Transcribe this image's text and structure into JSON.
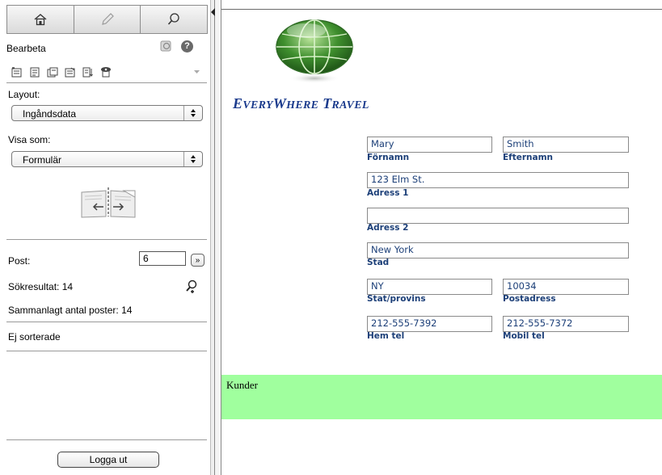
{
  "sidebar": {
    "title": "Bearbeta",
    "layout_label": "Layout:",
    "layout_value": "Ingåndsdata",
    "view_label": "Visa som:",
    "view_value": "Formulär",
    "record_label": "Post:",
    "record_value": "6",
    "found_label": "Sökresultat: 14",
    "total_label": "Sammanlagt antal poster: 14",
    "sort_label": "Ej sorterade",
    "logout_label": "Logga ut",
    "next_glyph": "»",
    "icons": [
      "home-icon",
      "pencil-icon",
      "search-icon"
    ]
  },
  "content": {
    "brand": {
      "e": "E",
      "very": "VERY",
      "w": "W",
      "here": "HERE",
      "t": "T",
      "ravel": "RAVEL"
    },
    "fields": {
      "first_name": {
        "value": "Mary",
        "label": "Förnamn"
      },
      "last_name": {
        "value": "Smith",
        "label": "Efternamn"
      },
      "address1": {
        "value": "123 Elm St.",
        "label": "Adress 1"
      },
      "address2": {
        "value": "",
        "label": "Adress 2"
      },
      "city": {
        "value": "New York",
        "label": "Stad"
      },
      "state": {
        "value": "NY",
        "label": "Stat/provins"
      },
      "zip": {
        "value": "10034",
        "label": "Postadress"
      },
      "home_phone": {
        "value": "212-555-7392",
        "label": "Hem tel"
      },
      "mobile_phone": {
        "value": "212-555-7372",
        "label": "Mobil tel"
      }
    },
    "footer_label": "Kunder"
  },
  "colors": {
    "brand": "#1a3a8c",
    "field_text": "#1c3f78",
    "footer_bg": "#a0ff9e"
  }
}
